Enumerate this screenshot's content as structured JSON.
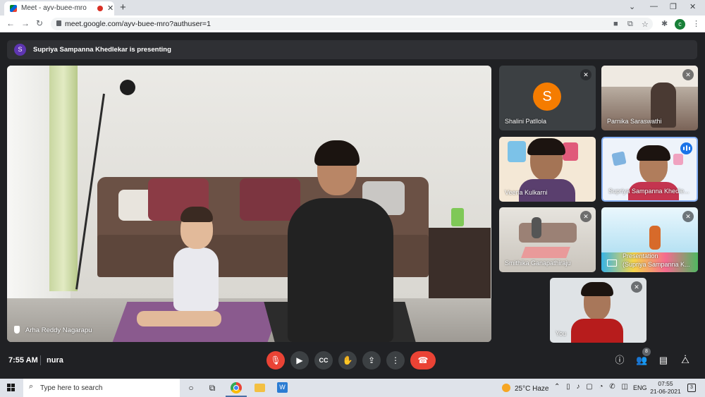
{
  "browser": {
    "tab_title": "Meet - ayv-buee-mro",
    "tab_close": "✕",
    "new_tab": "+",
    "url": "meet.google.com/ayv-buee-mro?authuser=1",
    "profile_initial": "c",
    "win_controls": [
      "⌄",
      "—",
      "❐",
      "✕"
    ]
  },
  "banner": {
    "avatar_initial": "S",
    "text": "Supriya Sampanna Khedlekar is presenting"
  },
  "main_video": {
    "name": "Arha Reddy Nagarapu"
  },
  "tiles": [
    {
      "name": "Shalini Patllola",
      "initial": "S",
      "muted": true
    },
    {
      "name": "Parnika Saraswathi",
      "muted": true
    },
    {
      "name": "Veena Kulkarni",
      "muted": false
    },
    {
      "name": "Supriya Sampanna Khedle...",
      "speaking": true
    },
    {
      "name": "Smithika Ganapathiraju",
      "muted": true
    },
    {
      "name": "Presentation",
      "name2": "(Supriya Sampanna K...",
      "presentation": true
    },
    {
      "name": "You",
      "muted": true
    }
  ],
  "bottom_bar": {
    "time": "7:55 AM",
    "meeting_code": "nura",
    "participant_count": "8"
  },
  "taskbar": {
    "search_placeholder": "Type here to search",
    "weather_temp": "25°C",
    "weather_desc": "Haze",
    "lang": "ENG",
    "time": "07:55",
    "date": "21-06-2021",
    "notif_count": "3"
  },
  "colors": {
    "background": "#202124",
    "end_call": "#ea4335",
    "speaking_blue": "#1a73e8",
    "avatar_orange": "#f57c00"
  }
}
